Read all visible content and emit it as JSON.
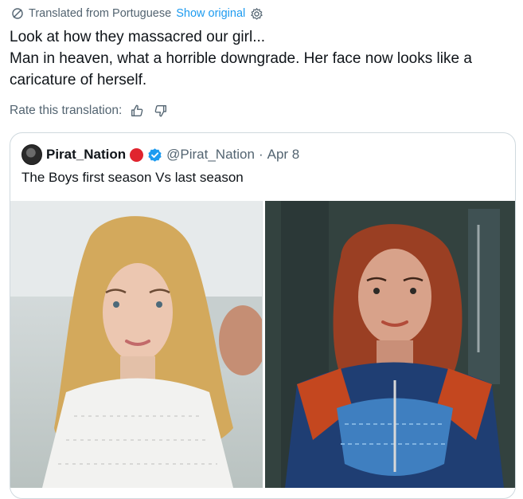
{
  "translation": {
    "text": "Translated from Portuguese",
    "show_original": "Show original",
    "icon": "globe-arrows-icon",
    "settings_icon": "gear-icon"
  },
  "tweet": {
    "lines": [
      "Look at how they massacred our girl...",
      "Man in heaven, what a horrible downgrade. Her face now looks like a caricature of herself."
    ]
  },
  "rate": {
    "label": "Rate this translation:",
    "up_icon": "thumbs-up-icon",
    "down_icon": "thumbs-down-icon"
  },
  "quote": {
    "name": "Pirat_Nation",
    "handle": "@Pirat_Nation",
    "separator": "·",
    "date": "Apr 8",
    "text": "The Boys first season Vs last season",
    "badge_color": "#e0242e",
    "verified_color": "#1d9bf0"
  },
  "media": [
    {
      "icon": "photo-blonde-woman-icon"
    },
    {
      "icon": "photo-redhead-superhero-icon"
    }
  ]
}
